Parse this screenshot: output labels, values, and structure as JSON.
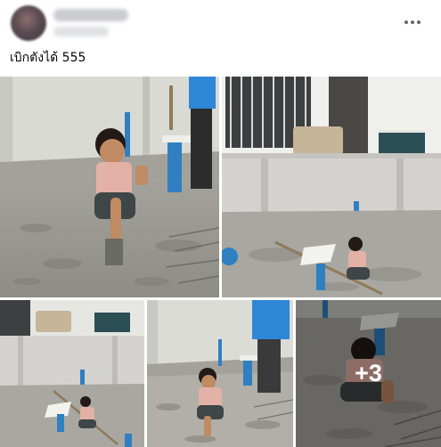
{
  "post": {
    "caption": "เบิกตังได้ 555",
    "more_photos_label": "+3"
  },
  "icons": {
    "more_options": "more-horizontal-dots-icon"
  },
  "colors": {
    "concrete": "#a8a6a1",
    "wall": "#dcdcd8",
    "pipe_blue": "#2f7fc1",
    "shirt_blue": "#2e86d6",
    "overlay_text": "#ffffff"
  }
}
